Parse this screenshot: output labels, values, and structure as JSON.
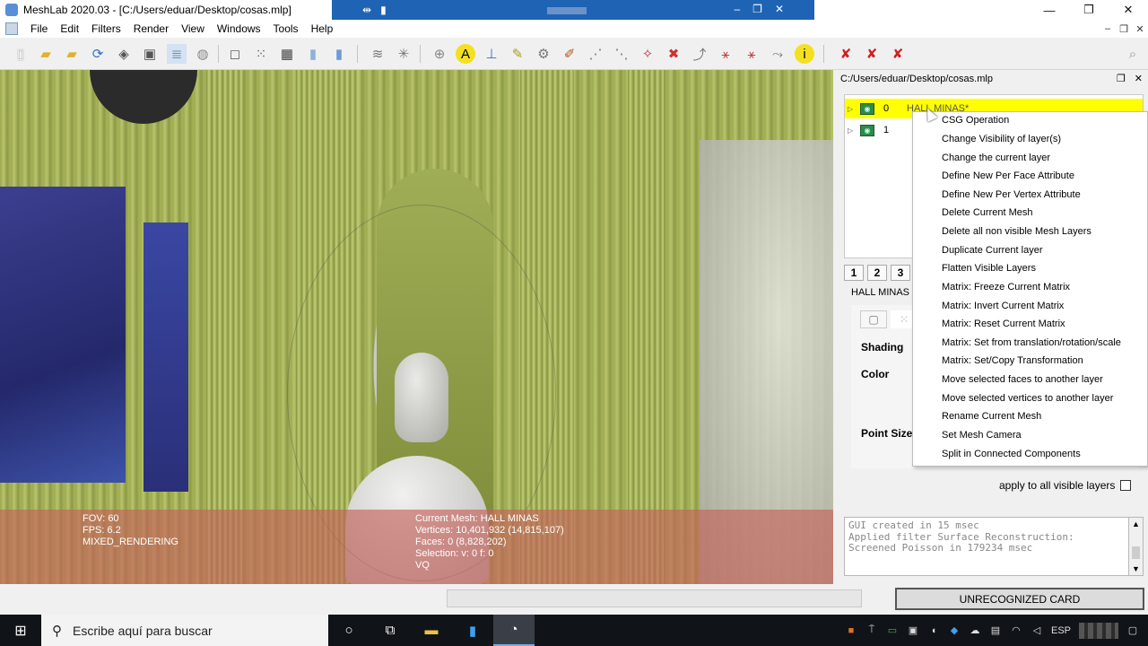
{
  "titlebar": {
    "title": "MeshLab 2020.03 - [C:/Users/eduar/Desktop/cosas.mlp]",
    "minimize": "—",
    "maximize": "❐",
    "close": "✕"
  },
  "remote_bar": {
    "pin": "⇹",
    "signal": "▮",
    "min": "–",
    "restore": "❐",
    "close": "✕"
  },
  "menu": {
    "items": [
      "File",
      "Edit",
      "Filters",
      "Render",
      "View",
      "Windows",
      "Tools",
      "Help"
    ],
    "doc_min": "–",
    "doc_restore": "❐",
    "doc_close": "✕"
  },
  "toolbar": {
    "icons": [
      "new-project-icon",
      "open-project-icon",
      "open-mesh-icon",
      "reload-icon",
      "save-icon",
      "snapshot-icon",
      "layers-icon",
      "view-icon",
      "bbox-icon",
      "points-icon",
      "wireframe-icon",
      "flat-icon",
      "smooth-icon",
      "texture-icon",
      "light-icon",
      "trackball-icon",
      "annotation-icon",
      "measure-icon",
      "paint-icon",
      "select-icon",
      "align-icon",
      "brush-icon",
      "select-faces-icon",
      "select-vertices-icon",
      "color-icon",
      "georef-icon",
      "transform-icon",
      "select-connected-icon",
      "select-area-icon",
      "pick-icon",
      "info-icon",
      "delete-faces-icon",
      "delete-vertices-icon",
      "delete-all-icon",
      "search-icon"
    ]
  },
  "viewport": {
    "hud_left": [
      "FOV: 60",
      "FPS:   6.2",
      "MIXED_RENDERING"
    ],
    "hud_mid": [
      "Current Mesh: HALL  MINAS",
      "Vertices: 10,401,932    (14,815,107)",
      "Faces: 0    (8,828,202)",
      "Selection: v: 0 f: 0",
      "VQ"
    ]
  },
  "panel": {
    "header": "C:/Users/eduar/Desktop/cosas.mlp",
    "float": "❐",
    "close": "✕",
    "layers": [
      {
        "id": "0",
        "name": "HALL  MINAS*"
      },
      {
        "id": "1",
        "name": ""
      }
    ],
    "tabs": [
      "1",
      "2",
      "3"
    ],
    "mesh_label": "HALL  MINAS",
    "render_labels": {
      "shading": "Shading",
      "color": "Color",
      "point_size": "Point Size"
    },
    "apply_label": "apply to all visible layers",
    "log": [
      "GUI created in 15 msec",
      "Applied filter Surface Reconstruction:",
      "Screened Poisson in 179234 msec"
    ]
  },
  "context_menu": {
    "items": [
      "CSG Operation",
      "Change Visibility of layer(s)",
      "Change the current layer",
      "Define New Per Face Attribute",
      "Define New Per Vertex Attribute",
      "Delete Current Mesh",
      "Delete all non visible Mesh Layers",
      "Duplicate Current layer",
      "Flatten Visible Layers",
      "Matrix: Freeze Current Matrix",
      "Matrix: Invert Current Matrix",
      "Matrix: Reset Current Matrix",
      "Matrix: Set from translation/rotation/scale",
      "Matrix: Set/Copy Transformation",
      "Move selected faces to another layer",
      "Move selected vertices to another layer",
      "Rename Current Mesh",
      "Set Mesh Camera",
      "Split in Connected Components"
    ]
  },
  "statusbar": {
    "card": "UNRECOGNIZED CARD"
  },
  "taskbar": {
    "search_placeholder": "Escribe aquí para buscar",
    "language": "ESP"
  },
  "colors": {
    "accent": "#1f63b5",
    "layer_selected": "#ffff00",
    "hud_bg": "#c4625c"
  }
}
